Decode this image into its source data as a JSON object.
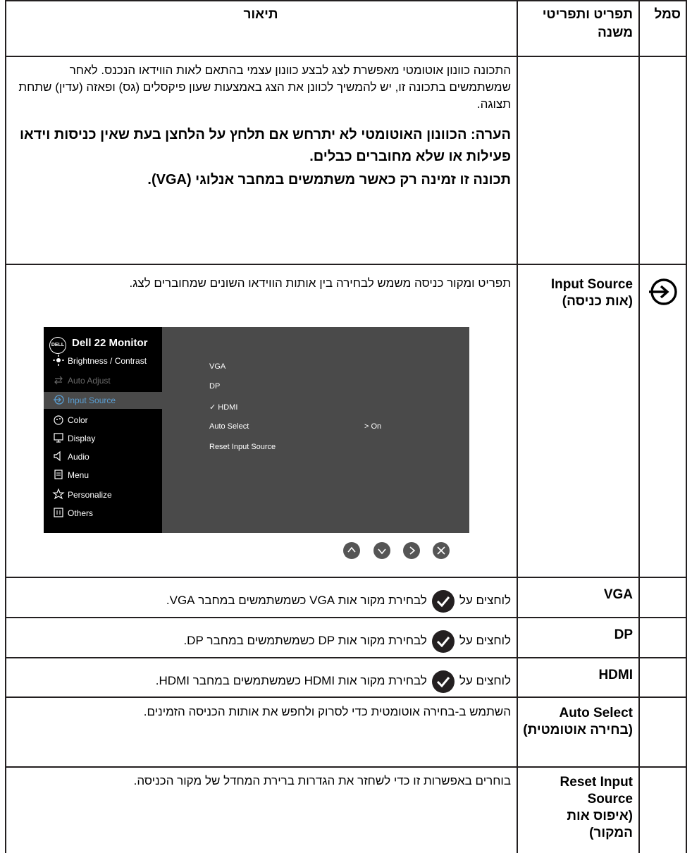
{
  "headers": {
    "symbol": "סמל",
    "item": "תפריט ותפריטי משנה",
    "description": "תיאור"
  },
  "auto_adjust": {
    "text": "התכונה כוונון אוטומטי מאפשרת לצג לבצע כוונון עצמי בהתאם לאות הווידאו הנכנס. לאחר שמשתמשים בתכונה זו, יש להמשיך לכוונן את הצג באמצעות שעון פיקסלים (גס) ופאזה (עדין) שתחת תצוגה.",
    "note1": "הערה: הכוונון האוטומטי לא יתרחש אם תלחץ על הלחצן בעת שאין כניסות וידאו פעילות או שלא מחוברים כבלים.",
    "note2": "תכונה זו זמינה רק כאשר משתמשים במחבר אנלוגי (VGA)."
  },
  "input_source": {
    "icon": "input-source-icon",
    "name_en": "Input Source",
    "name_he": "(אות כניסה)",
    "text": "תפריט ומקור כניסה משמש לבחירה בין אותות הווידאו השונים שמחוברים לצג."
  },
  "osd": {
    "title": "Dell 22 Monitor",
    "logo": "DELL",
    "menu": [
      {
        "label": "Brightness / Contrast",
        "icon": "brightness-icon"
      },
      {
        "label": "Auto Adjust",
        "icon": "auto-adjust-icon"
      },
      {
        "label": "Input Source",
        "icon": "input-source-icon"
      },
      {
        "label": "Color",
        "icon": "color-icon"
      },
      {
        "label": "Display",
        "icon": "display-icon"
      },
      {
        "label": "Audio",
        "icon": "audio-icon"
      },
      {
        "label": "Menu",
        "icon": "menu-icon"
      },
      {
        "label": "Personalize",
        "icon": "star-icon"
      },
      {
        "label": "Others",
        "icon": "others-icon"
      }
    ],
    "options": [
      "VGA",
      "DP",
      "✓ HDMI",
      "Auto Select",
      "Reset Input Source"
    ],
    "auto_select_value": "> On",
    "nav": [
      "up-icon",
      "down-icon",
      "right-icon",
      "close-icon"
    ],
    "accent": "#5a9fd4"
  },
  "rows": [
    {
      "name": "VGA",
      "pre": "לוחצים על",
      "post": "לבחירת מקור אות VGA כשמשתמשים במחבר VGA."
    },
    {
      "name": "DP",
      "pre": "לוחצים על",
      "post": "לבחירת מקור אות DP כשמשתמשים במחבר DP."
    },
    {
      "name": "HDMI",
      "pre": "לוחצים על",
      "post": "לבחירת מקור אות HDMI כשמשתמשים במחבר HDMI."
    }
  ],
  "auto_select": {
    "name_en": "Auto Select",
    "name_he": "(בחירה אוטומטית)",
    "text": "השתמש ב-בחירה אוטומטית כדי לסרוק ולחפש את אותות הכניסה הזמינים."
  },
  "reset": {
    "name_en": "Reset Input Source",
    "name_he": "(איפוס אות המקור)",
    "text": "בוחרים באפשרות זו כדי לשחזר את הגדרות ברירת המחדל של מקור הכניסה."
  }
}
